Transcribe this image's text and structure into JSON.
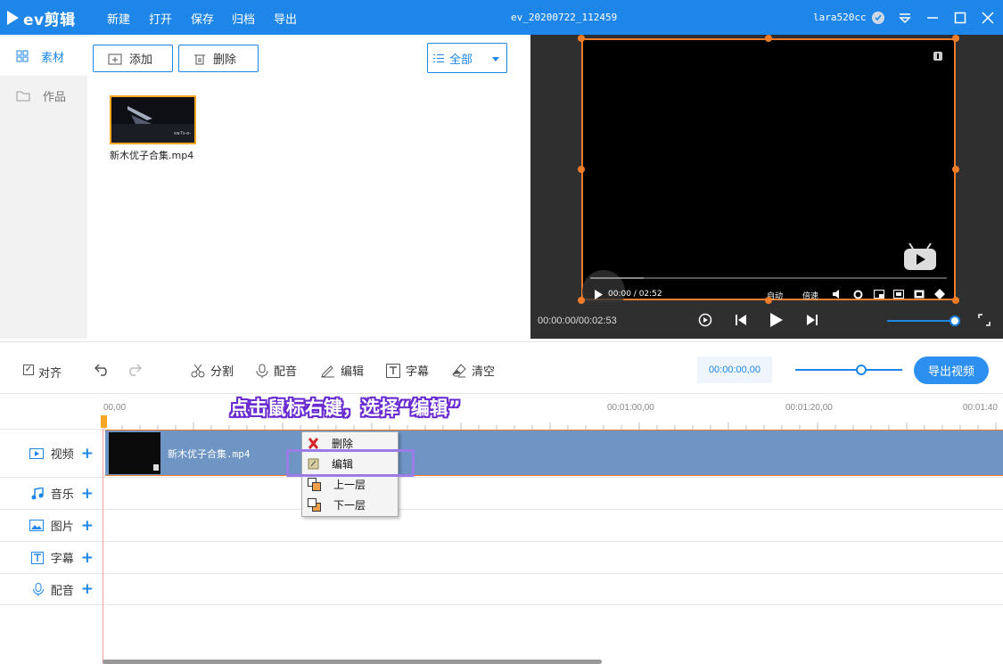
{
  "app": {
    "logo_text": "ev剪辑",
    "project_title": "ev_20200722_112459",
    "username": "lara520cc"
  },
  "menu": [
    "新建",
    "打开",
    "保存",
    "归档",
    "导出"
  ],
  "window_controls": [
    "badge-icon",
    "dropdown-icon",
    "minimize-icon",
    "maximize-icon",
    "close-icon"
  ],
  "library": {
    "nav": [
      {
        "label": "素材",
        "icon": "grid-icon",
        "active": true
      },
      {
        "label": "作品",
        "icon": "folder-icon",
        "active": false
      }
    ],
    "add_label": "添加",
    "delete_label": "删除",
    "filter_selected": "全部",
    "items": [
      {
        "name": "新木优子合集.mp4",
        "thumb_caption": "sw7s-e-"
      }
    ]
  },
  "preview": {
    "player_time": "00:00 / 02:52",
    "player_labels": [
      "自动",
      "倍速"
    ],
    "timecode": "00:00:00/00:02:53",
    "volume_level": 0.95
  },
  "toolbar": {
    "align_label": "对齐",
    "align_checked": true,
    "split_label": "分割",
    "dub_label": "配音",
    "edit_label": "编辑",
    "subtitle_label": "字幕",
    "clear_label": "清空",
    "timecode_value": "00:00:00,00",
    "zoom_level": 0.62,
    "export_label": "导出视频"
  },
  "timeline": {
    "ruler_labels": [
      "00,00",
      "00:01:00,00",
      "00:01:20,00",
      "00:01:40"
    ],
    "annotation": "点击鼠标右键，选择“编辑”",
    "tracks": [
      {
        "label": "视频",
        "icon": "video-icon"
      },
      {
        "label": "音乐",
        "icon": "music-icon"
      },
      {
        "label": "图片",
        "icon": "image-icon"
      },
      {
        "label": "字幕",
        "icon": "subtitle-icon"
      },
      {
        "label": "配音",
        "icon": "mic-icon"
      }
    ],
    "clip_name": "新木优子合集.mp4"
  },
  "context_menu": [
    {
      "label": "删除",
      "icon": "delete-x-icon"
    },
    {
      "label": "编辑",
      "icon": "edit-icon"
    },
    {
      "label": "上一层",
      "icon": "layer-up-icon"
    },
    {
      "label": "下一层",
      "icon": "layer-down-icon"
    }
  ],
  "colors": {
    "accent": "#1e86e8",
    "selection": "#f07c2a",
    "clip": "#6e95c4",
    "highlight_box": "#9b7be6"
  }
}
